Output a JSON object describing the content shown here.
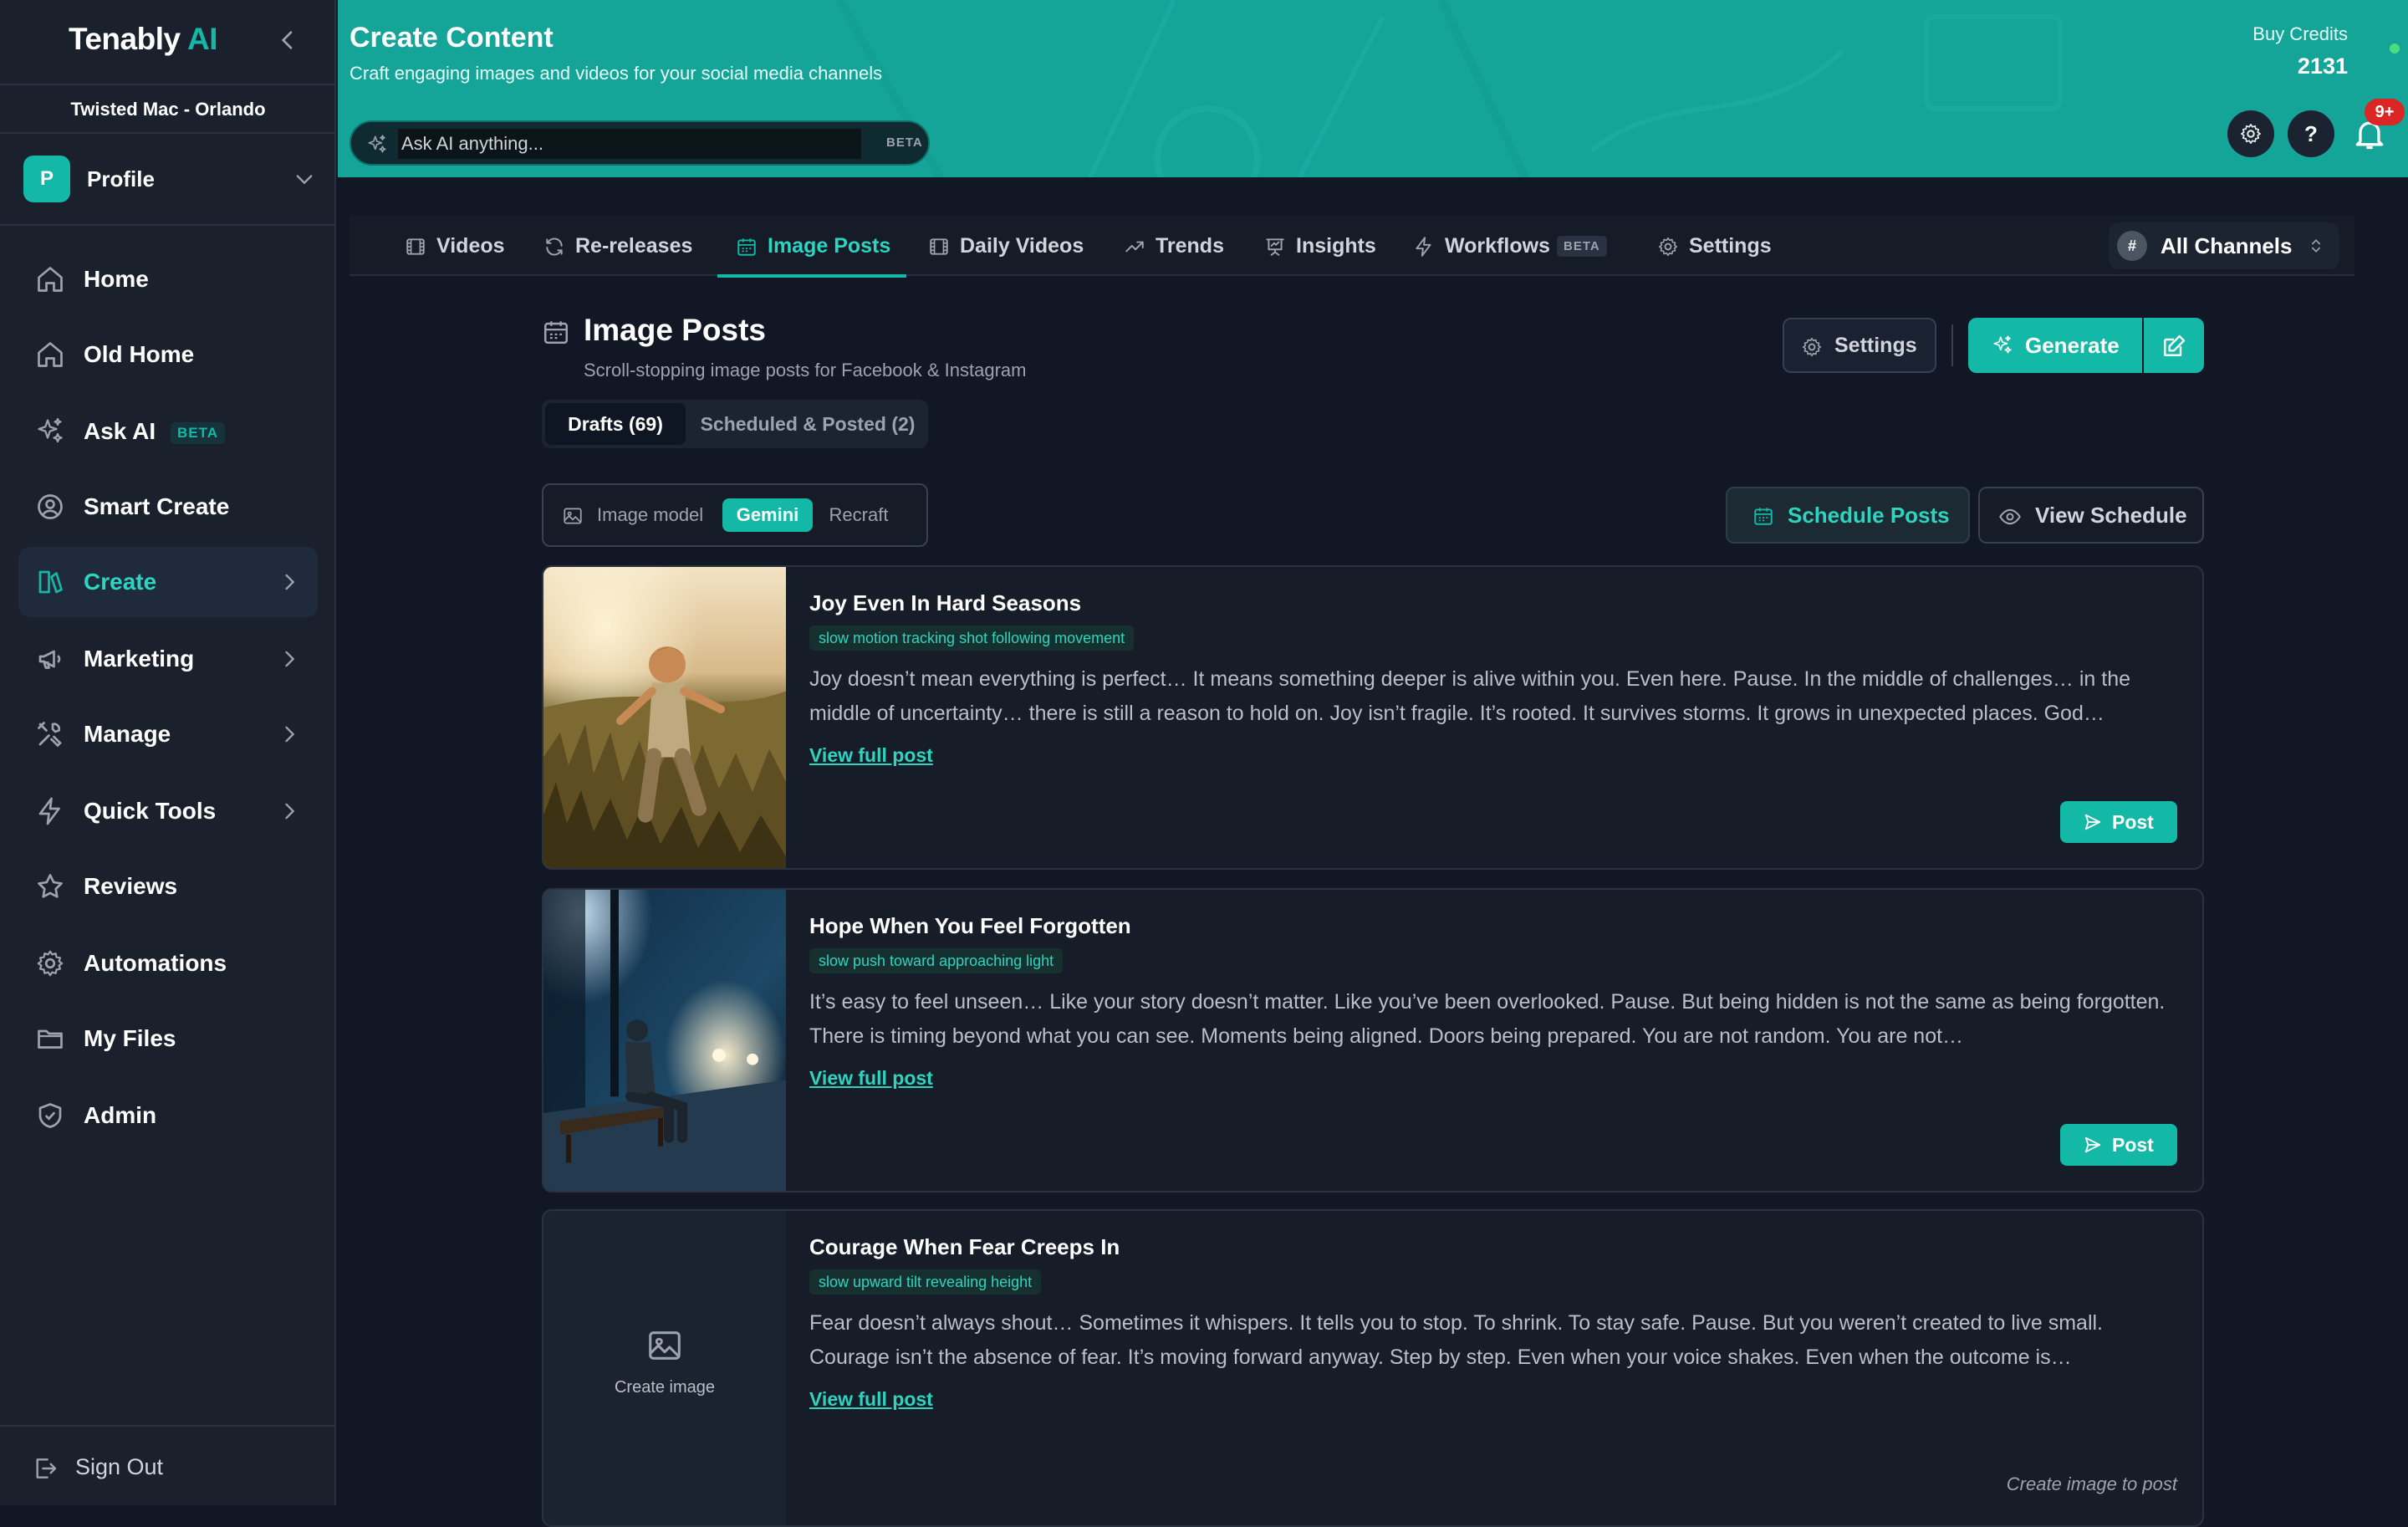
{
  "sidebar": {
    "logo_main": "Tenably",
    "logo_accent": "AI",
    "org_name": "Twisted Mac - Orlando",
    "profile": {
      "initial": "P",
      "label": "Profile"
    },
    "items": [
      {
        "label": "Home",
        "icon": "home-icon"
      },
      {
        "label": "Old Home",
        "icon": "home-icon"
      },
      {
        "label": "Ask AI",
        "icon": "sparkles-icon",
        "badge": "BETA"
      },
      {
        "label": "Smart Create",
        "icon": "user-circle-icon"
      },
      {
        "label": "Create",
        "icon": "create-icon",
        "active": true
      },
      {
        "label": "Marketing",
        "icon": "megaphone-icon"
      },
      {
        "label": "Manage",
        "icon": "tools-icon"
      },
      {
        "label": "Quick Tools",
        "icon": "lightning-icon"
      },
      {
        "label": "Reviews",
        "icon": "star-icon"
      },
      {
        "label": "Automations",
        "icon": "gear-icon"
      },
      {
        "label": "My Files",
        "icon": "folder-icon"
      },
      {
        "label": "Admin",
        "icon": "shield-icon"
      }
    ],
    "sign_out": "Sign Out"
  },
  "header": {
    "title": "Create Content",
    "subtitle": "Craft engaging images and videos for your social media channels",
    "ask_placeholder": "Ask AI anything...",
    "ask_badge": "BETA",
    "credits_label": "Buy Credits",
    "credits_value": "2131",
    "notifications": "9+",
    "help_label": "?"
  },
  "tabs": [
    {
      "label": "Videos",
      "icon": "film-icon"
    },
    {
      "label": "Re-releases",
      "icon": "refresh-icon"
    },
    {
      "label": "Image Posts",
      "icon": "calendar-icon",
      "active": true
    },
    {
      "label": "Daily Videos",
      "icon": "film-icon"
    },
    {
      "label": "Trends",
      "icon": "trending-icon"
    },
    {
      "label": "Insights",
      "icon": "presentation-icon"
    },
    {
      "label": "Workflows",
      "icon": "lightning-icon",
      "badge": "BETA"
    },
    {
      "label": "Settings",
      "icon": "gear-icon"
    }
  ],
  "channels": {
    "hash": "#",
    "label": "All Channels"
  },
  "section": {
    "title": "Image Posts",
    "subtitle": "Scroll-stopping image posts for Facebook & Instagram",
    "settings_label": "Settings",
    "generate_label": "Generate",
    "drafts_label": "Drafts (69)",
    "scheduled_label": "Scheduled & Posted (2)",
    "model_label": "Image model",
    "model_options": [
      "Gemini",
      "Recraft"
    ],
    "model_selected": "Gemini",
    "schedule_label": "Schedule Posts",
    "view_schedule_label": "View Schedule"
  },
  "posts": [
    {
      "title": "Joy Even In Hard Seasons",
      "tag": "slow motion tracking shot following movement",
      "body": "Joy doesn’t mean everything is perfect… It means something deeper is alive within you. Even here. Pause. In the middle of challenges… in the middle of uncertainty… there is still a reason to hold on. Joy isn’t fragile. It’s rooted. It survives storms. It grows in unexpected places. God…",
      "view_label": "View full post",
      "post_label": "Post"
    },
    {
      "title": "Hope When You Feel Forgotten",
      "tag": "slow push toward approaching light",
      "body": "It’s easy to feel unseen… Like your story doesn’t matter. Like you’ve been overlooked. Pause. But being hidden is not the same as being forgotten. There is timing beyond what you can see. Moments being aligned. Doors being prepared. You are not random. You are not…",
      "view_label": "View full post",
      "post_label": "Post"
    },
    {
      "title": "Courage When Fear Creeps In",
      "tag": "slow upward tilt revealing height",
      "body": "Fear doesn’t always shout… Sometimes it whispers. It tells you to stop. To shrink. To stay safe. Pause. But you weren’t created to live small. Courage isn’t the absence of fear. It’s moving forward anyway. Step by step. Even when your voice shakes. Even when the outcome is…",
      "view_label": "View full post",
      "create_image_label": "Create image",
      "hint": "Create image to post"
    }
  ],
  "colors": {
    "accent": "#14b8a6",
    "header_bg": "#14a498",
    "page_bg": "#111724",
    "sidebar_bg": "#1a202c",
    "badge_red": "#dc2626"
  }
}
